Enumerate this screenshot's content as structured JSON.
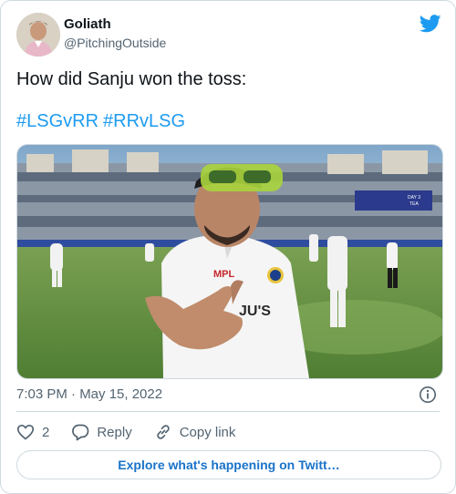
{
  "author": {
    "name": "Goliath",
    "handle": "@PitchingOutside"
  },
  "tweet": {
    "text": "How did Sanju won the toss:",
    "hashtags": [
      "#LSGvRR",
      "#RRvLSG"
    ],
    "timestamp": "7:03 PM · May 15, 2022"
  },
  "media": {
    "description": "cricket player in white kit and sunglasses gesturing toward camera on field",
    "scoreboard": "DAY 3 TEA"
  },
  "actions": {
    "likes": "2",
    "reply_label": "Reply",
    "copy_link_label": "Copy link"
  },
  "explore_label": "Explore what's happening on Twitt…",
  "colors": {
    "accent": "#1d9bf0",
    "text": "#0f1419",
    "secondary": "#536471"
  },
  "icons": [
    "twitter-bird-icon",
    "info-icon",
    "heart-icon",
    "reply-icon",
    "link-icon"
  ]
}
